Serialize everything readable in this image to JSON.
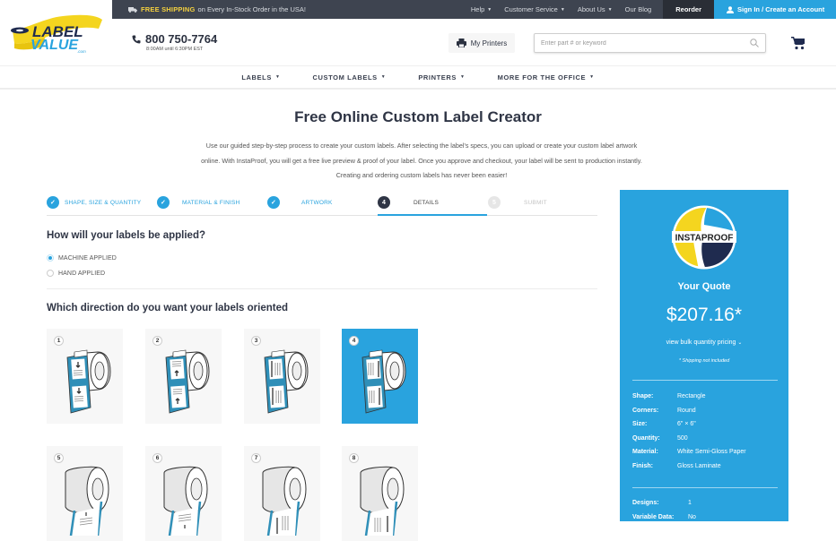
{
  "topbar": {
    "shipping_highlight": "FREE SHIPPING",
    "shipping_text": "on Every In-Stock Order in the USA!",
    "links": [
      {
        "label": "Help",
        "dropdown": true
      },
      {
        "label": "Customer Service",
        "dropdown": true
      },
      {
        "label": "About Us",
        "dropdown": true
      },
      {
        "label": "Our Blog",
        "dropdown": false
      }
    ],
    "reorder_label": "Reorder",
    "signin_label": "Sign In / Create an Account"
  },
  "brand": {
    "logo_line1": "LABEL",
    "logo_line2": "VALUE",
    "logo_suffix": ".com",
    "colors": {
      "yellow": "#f4d51f",
      "blue": "#29a3de",
      "navy": "#1f2b4f"
    }
  },
  "contact": {
    "phone": "800 750-7764",
    "hours": "8:00AM until 6:30PM EST"
  },
  "header": {
    "my_printers_label": "My Printers",
    "search_placeholder": "Enter part # or keyword",
    "search_value": ""
  },
  "mainnav": {
    "items": [
      {
        "label": "LABELS"
      },
      {
        "label": "CUSTOM LABELS"
      },
      {
        "label": "PRINTERS"
      },
      {
        "label": "MORE FOR THE OFFICE"
      }
    ]
  },
  "hero": {
    "title": "Free Online Custom Label Creator",
    "line1": "Use our guided step-by-step process to create your custom labels. After selecting the label's specs, you can upload or create your custom label artwork",
    "line2": "online. With InstaProof, you will get a free live preview & proof of your label. Once you approve and checkout, your label will be sent to production instantly.",
    "line3": "Creating and ordering custom labels has never been easier!"
  },
  "steps": [
    {
      "number": "1",
      "label": "SHAPE, SIZE & QUANTITY",
      "status": "done"
    },
    {
      "number": "2",
      "label": "MATERIAL & FINISH",
      "status": "done"
    },
    {
      "number": "3",
      "label": "ARTWORK",
      "status": "done"
    },
    {
      "number": "4",
      "label": "DETAILS",
      "status": "current"
    },
    {
      "number": "5",
      "label": "SUBMIT",
      "status": "todo"
    }
  ],
  "application": {
    "question": "How will your labels be applied?",
    "options": [
      {
        "label": "MACHINE APPLIED",
        "selected": true
      },
      {
        "label": "HAND APPLIED",
        "selected": false
      }
    ]
  },
  "orientation": {
    "question": "Which direction do you want your labels oriented",
    "selected": "4",
    "options": [
      {
        "number": "1"
      },
      {
        "number": "2"
      },
      {
        "number": "3"
      },
      {
        "number": "4"
      },
      {
        "number": "5"
      },
      {
        "number": "6"
      },
      {
        "number": "7"
      },
      {
        "number": "8"
      }
    ]
  },
  "quote": {
    "badge_text": "INSTAPROOF",
    "title": "Your Quote",
    "price": "$207.16*",
    "bulk_link": "view bulk quantity pricing",
    "shipping_note": "* Shipping not included",
    "specs": [
      {
        "key": "Shape:",
        "value": "Rectangle"
      },
      {
        "key": "Corners:",
        "value": "Round"
      },
      {
        "key": "Size:",
        "value": "6\" × 6\""
      },
      {
        "key": "Quantity:",
        "value": "500"
      },
      {
        "key": "Material:",
        "value": "White Semi-Gloss Paper"
      },
      {
        "key": "Finish:",
        "value": "Gloss Laminate"
      }
    ],
    "extras": [
      {
        "key": "Designs:",
        "value": "1"
      },
      {
        "key": "Variable Data:",
        "value": "No"
      }
    ]
  }
}
